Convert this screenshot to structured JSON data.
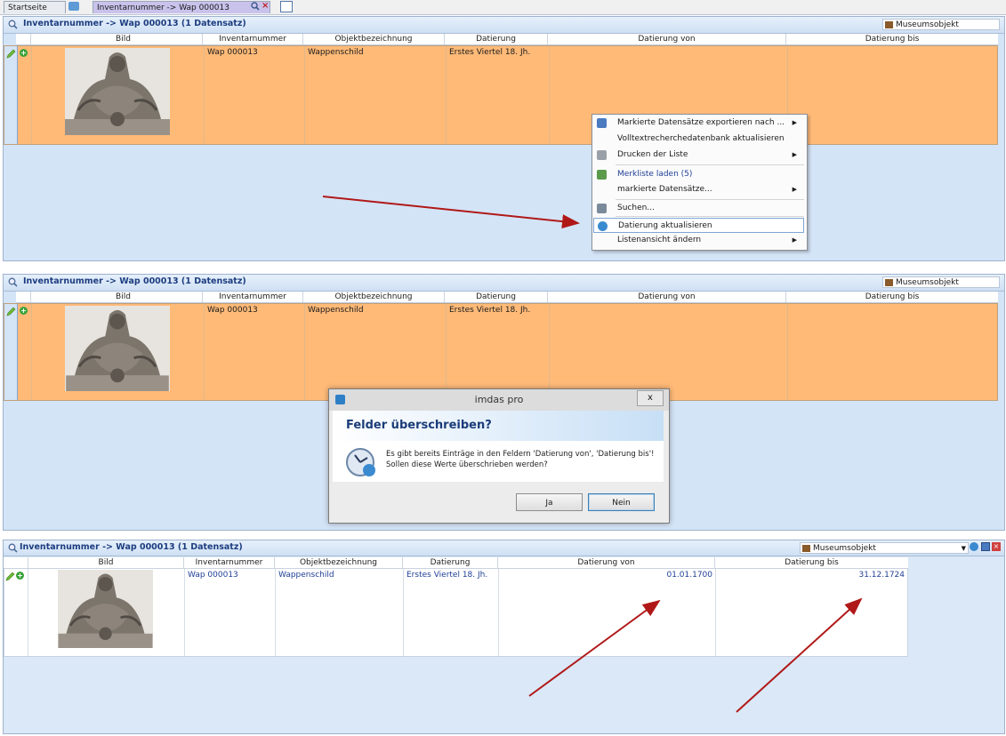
{
  "tabs": [
    {
      "label": "Startseite",
      "active": false
    },
    {
      "label": "Inventarnummer -> Wap 000013",
      "active": true
    }
  ],
  "panels": [
    {
      "title": "Inventarnummer -> Wap 000013 (1 Datensatz)",
      "object_type": "Museumsobjekt",
      "columns": [
        "Bild",
        "Inventarnummer",
        "Objektbezeichnung",
        "Datierung",
        "Datierung von",
        "Datierung bis"
      ],
      "row": {
        "inventarnummer": "Wap 000013",
        "objektbezeichnung": "Wappenschild",
        "datierung": "Erstes Viertel 18. Jh.",
        "datierung_von": "",
        "datierung_bis": ""
      }
    },
    {
      "title": "Inventarnummer -> Wap 000013 (1 Datensatz)",
      "object_type": "Museumsobjekt",
      "columns": [
        "Bild",
        "Inventarnummer",
        "Objektbezeichnung",
        "Datierung",
        "Datierung von",
        "Datierung bis"
      ],
      "row": {
        "inventarnummer": "Wap 000013",
        "objektbezeichnung": "Wappenschild",
        "datierung": "Erstes Viertel 18. Jh.",
        "datierung_von": "",
        "datierung_bis": ""
      }
    },
    {
      "title": "Inventarnummer -> Wap 000013 (1 Datensatz)",
      "object_type": "Museumsobjekt",
      "columns": [
        "Bild",
        "Inventarnummer",
        "Objektbezeichnung",
        "Datierung",
        "Datierung von",
        "Datierung bis"
      ],
      "row": {
        "inventarnummer": "Wap 000013",
        "objektbezeichnung": "Wappenschild",
        "datierung": "Erstes Viertel 18. Jh.",
        "datierung_von": "01.01.1700",
        "datierung_bis": "31.12.1724"
      }
    }
  ],
  "context_menu": {
    "items": [
      {
        "label": "Markierte Datensätze exportieren nach ...",
        "submenu": true,
        "icon": "export-icon"
      },
      {
        "label": "Volltextrecherchedatenbank aktualisieren",
        "submenu": false,
        "icon": ""
      },
      {
        "label": "Drucken der Liste",
        "submenu": true,
        "icon": "printer-icon"
      },
      {
        "label": "Merkliste laden (5)",
        "submenu": false,
        "icon": "bookmark-icon"
      },
      {
        "label": "markierte Datensätze...",
        "submenu": true,
        "icon": ""
      },
      {
        "label": "Suchen...",
        "submenu": false,
        "icon": "search-icon"
      },
      {
        "label": "Datierung aktualisieren",
        "submenu": false,
        "icon": "update-icon",
        "highlighted": true
      },
      {
        "label": "Listenansicht ändern",
        "submenu": true,
        "icon": ""
      }
    ]
  },
  "dialog": {
    "title": "imdas pro",
    "close": "x",
    "heading": "Felder überschreiben?",
    "message_line1": "Es gibt bereits Einträge in den Feldern 'Datierung von', 'Datierung bis'!",
    "message_line2": "Sollen diese Werte überschrieben werden?",
    "yes_label": "Ja",
    "no_label": "Nein"
  },
  "colors": {
    "row_selected": "#ffba78",
    "panel_bg": "#d4e4f7",
    "title_text": "#1c3d80",
    "arrow": "#b01818"
  }
}
